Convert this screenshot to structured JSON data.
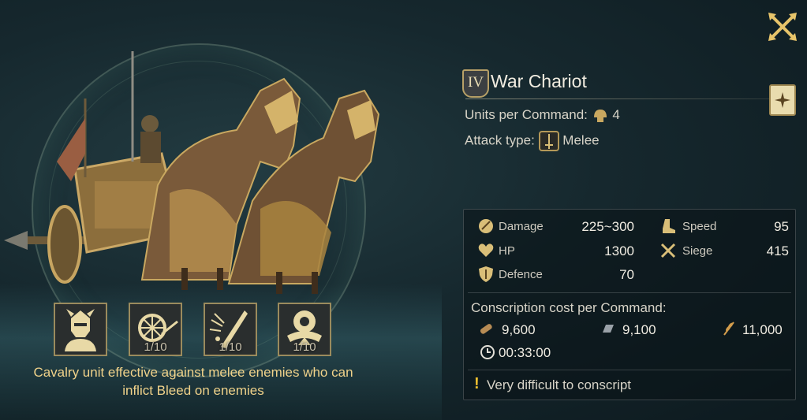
{
  "unit": {
    "tier": "IV",
    "name": "War Chariot",
    "units_per_command_label": "Units per Command:",
    "units_per_command_value": "4",
    "attack_type_label": "Attack type:",
    "attack_type_value": "Melee"
  },
  "stats": {
    "damage_label": "Damage",
    "damage_value": "225~300",
    "speed_label": "Speed",
    "speed_value": "95",
    "hp_label": "HP",
    "hp_value": "1300",
    "siege_label": "Siege",
    "siege_value": "415",
    "defence_label": "Defence",
    "defence_value": "70"
  },
  "conscription": {
    "label": "Conscription cost per Command:",
    "wood": "9,600",
    "iron": "9,100",
    "food": "11,000",
    "time": "00:33:00"
  },
  "warning": "Very difficult to conscript",
  "skills": [
    {
      "name": "knight-helm-icon",
      "level": ""
    },
    {
      "name": "wheel-slash-icon",
      "level": "1/10"
    },
    {
      "name": "blade-burst-icon",
      "level": "1/10"
    },
    {
      "name": "rider-emblem-icon",
      "level": "1/10"
    }
  ],
  "description_line1": "Cavalry unit effective against melee enemies who can",
  "description_line2": "inflict Bleed on enemies",
  "colors": {
    "gold": "#c9a860",
    "accent_text": "#f0d28a",
    "warning": "#f2c230"
  }
}
